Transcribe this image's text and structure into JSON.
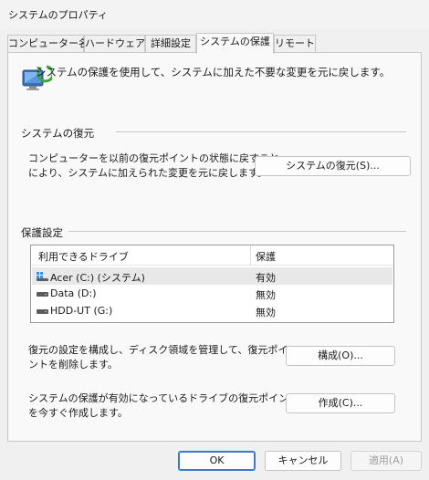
{
  "window": {
    "title": "システムのプロパティ"
  },
  "tabs": [
    {
      "label": "コンピューター名"
    },
    {
      "label": "ハードウェア"
    },
    {
      "label": "詳細設定"
    },
    {
      "label": "システムの保護",
      "active": true
    },
    {
      "label": "リモート"
    }
  ],
  "header": {
    "description": "システムの保護を使用して、システムに加えた不要な変更を元に戻します。"
  },
  "restore": {
    "title": "システムの復元",
    "line1": "コンピューターを以前の復元ポイントの状態に戻すこと",
    "line2": "により、システムに加えられた変更を元に戻します。",
    "button": "システムの復元(S)..."
  },
  "protection": {
    "title": "保護設定",
    "columns": [
      "利用できるドライブ",
      "保護"
    ],
    "drives": [
      {
        "name": "Acer (C:) (システム)",
        "status": "有効",
        "icon": "windows-drive-icon"
      },
      {
        "name": "Data (D:)",
        "status": "無効",
        "icon": "drive-icon"
      },
      {
        "name": "HDD-UT (G:)",
        "status": "無効",
        "icon": "drive-icon"
      }
    ]
  },
  "configure": {
    "line1": "復元の設定を構成し、ディスク領域を管理して、復元ポイ",
    "line2": "ントを削除します。",
    "button": "構成(O)..."
  },
  "create": {
    "line1": "システムの保護が有効になっているドライブの復元ポイント",
    "line2": "を今すぐ作成します。",
    "button": "作成(C)..."
  },
  "footer": {
    "ok": "OK",
    "cancel": "キャンセル",
    "apply": "適用(A)"
  },
  "colors": {
    "accent": "#3a78d4",
    "panel": "#f9f9f9",
    "window": "#f0f0f0"
  }
}
